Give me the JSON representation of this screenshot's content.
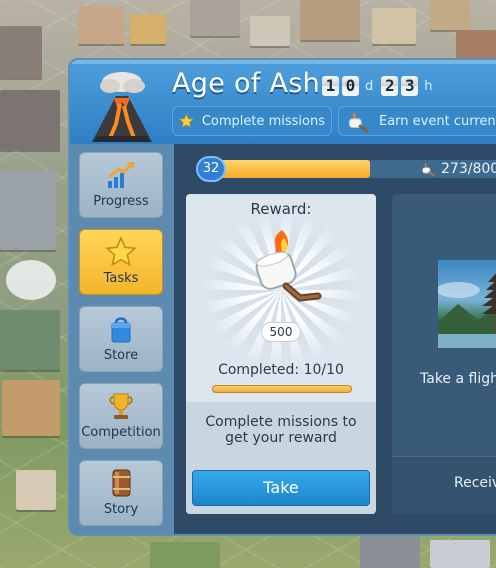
{
  "event": {
    "title": "Age of Ash",
    "timer": {
      "days_digits": [
        "1",
        "0"
      ],
      "days_unit": "d",
      "hours_digits": [
        "2",
        "3"
      ],
      "hours_unit": "h"
    },
    "missions": [
      {
        "label": "Complete missions",
        "icon": "star-icon"
      },
      {
        "label": "Earn event currency",
        "icon": "marshmallow-icon"
      }
    ]
  },
  "sidebar": {
    "items": [
      {
        "label": "Progress",
        "icon": "progress-arrow-icon",
        "active": false
      },
      {
        "label": "Tasks",
        "icon": "star-icon",
        "active": true
      },
      {
        "label": "Store",
        "icon": "shopping-bag-icon",
        "active": false
      },
      {
        "label": "Competition",
        "icon": "trophy-icon",
        "active": false
      },
      {
        "label": "Story",
        "icon": "book-icon",
        "active": false
      }
    ]
  },
  "progress": {
    "level": "32",
    "points_text": "273/800",
    "points_current": 273,
    "points_max": 800,
    "bar_fraction": 0.85
  },
  "reward_card": {
    "title": "Reward:",
    "reward_icon": "roasted-marshmallow-icon",
    "reward_count": "500",
    "completed_text": "Completed: 10/10",
    "completed_fraction": 1.0,
    "hint": "Complete missions to get your reward",
    "take_label": "Take"
  },
  "flight_card": {
    "image": "temple-photo",
    "text": "Take a flight",
    "receive_text": "Receive"
  },
  "colors": {
    "header_blue": "#3a8fd3",
    "active_tab": "#f4b52b",
    "take_button": "#1c86cd",
    "progress_fill": "#f3ad2a"
  }
}
